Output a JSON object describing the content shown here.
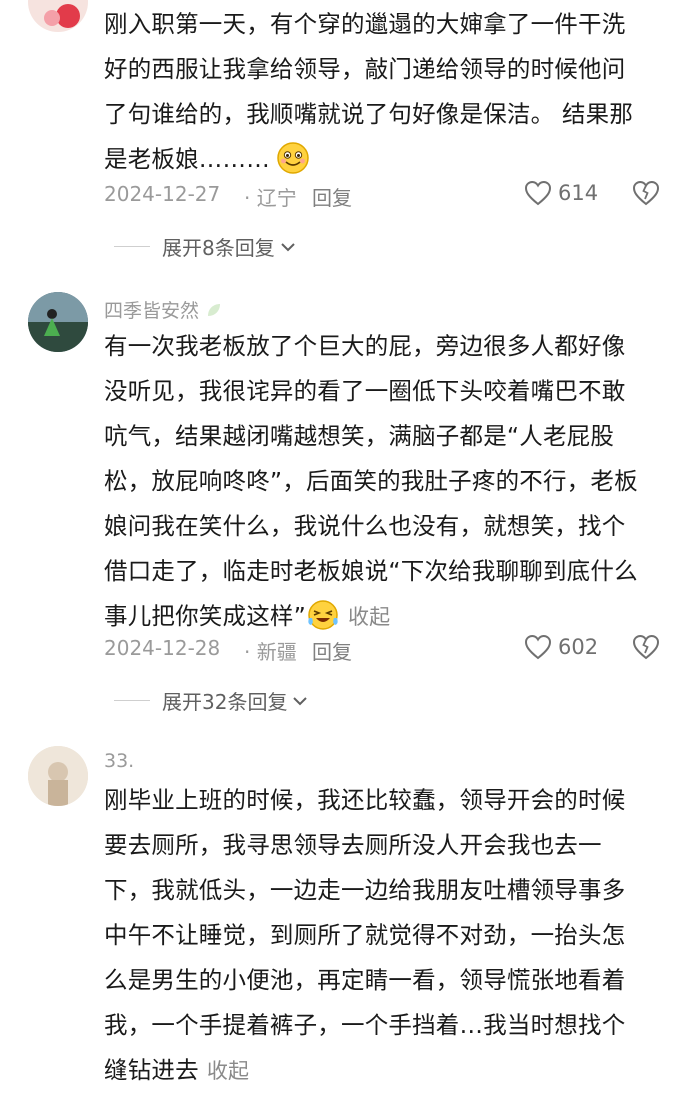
{
  "comments": [
    {
      "username": "",
      "lines": [
        "刚入职第一天，有个穿的邋遢的大婶拿了一件干洗",
        "好的西服让我拿给领导，敲门递给领导的时候他问",
        "了句谁给的，我顺嘴就说了句好像是保洁。 结果那",
        "是老板娘………"
      ],
      "emoji": "grin-emoji",
      "date": "2024-12-27",
      "location": "· 辽宁",
      "reply_label": "回复",
      "likes": "614",
      "expand_label": "展开8条回复"
    },
    {
      "username": "四季皆安然",
      "lines": [
        "有一次我老板放了个巨大的屁，旁边很多人都好像",
        "没听见，我很诧异的看了一圈低下头咬着嘴巴不敢",
        "吭气，结果越闭嘴越想笑，满脑子都是“人老屁股",
        "松，放屁响咚咚”，后面笑的我肚子疼的不行，老板",
        "娘问我在笑什么，我说什么也没有，就想笑，找个",
        "借口走了，临走时老板娘说“下次给我聊聊到底什么",
        "事儿把你笑成这样”"
      ],
      "emoji": "laugh-cry-emoji",
      "collapse_label": "收起",
      "date": "2024-12-28",
      "location": "· 新疆",
      "reply_label": "回复",
      "likes": "602",
      "expand_label": "展开32条回复"
    },
    {
      "username": "33.",
      "lines": [
        "刚毕业上班的时候，我还比较蠢，领导开会的时候",
        "要去厕所，我寻思领导去厕所没人开会我也去一",
        "下，我就低头，一边走一边给我朋友吐槽领导事多",
        "中午不让睡觉，到厕所了就觉得不对劲，一抬头怎",
        "么是男生的小便池，再定睛一看，领导慌张地看着",
        "我，一个手提着裤子，一个手挡着…我当时想找个",
        "缝钻进去"
      ],
      "collapse_label": "收起"
    }
  ],
  "colors": {
    "text": "#1a1a1a",
    "muted": "#9a9a9a",
    "divider": "#cfcfcf"
  }
}
